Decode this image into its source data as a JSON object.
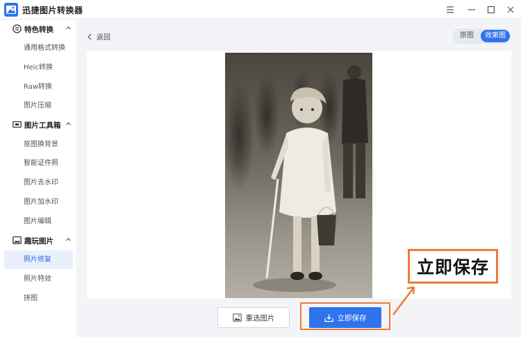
{
  "app": {
    "title": "迅捷图片转换器",
    "accent": "#2f73ee",
    "annotation_color": "#ee7a3a"
  },
  "window_controls": [
    "menu-icon",
    "minimize-icon",
    "maximize-icon",
    "close-icon"
  ],
  "sidebar": {
    "groups": [
      {
        "label": "特色转换",
        "icon": "convert-icon",
        "items": [
          "通用格式转换",
          "Heic转换",
          "Raw转换",
          "图片压缩"
        ]
      },
      {
        "label": "图片工具箱",
        "icon": "toolbox-icon",
        "items": [
          "抠图换背景",
          "智能证件照",
          "图片去水印",
          "图片加水印",
          "图片编辑"
        ]
      },
      {
        "label": "趣玩图片",
        "icon": "fun-image-icon",
        "items": [
          "照片修复",
          "照片特效",
          "拼图"
        ]
      }
    ],
    "active_item": "照片修复"
  },
  "main": {
    "back_label": "返回",
    "toggle": {
      "original": "原图",
      "effect": "效果图",
      "selected": "效果图"
    },
    "reselect_label": "重选图片",
    "save_label": "立即保存"
  },
  "annotation": {
    "callout_text": "立即保存"
  }
}
